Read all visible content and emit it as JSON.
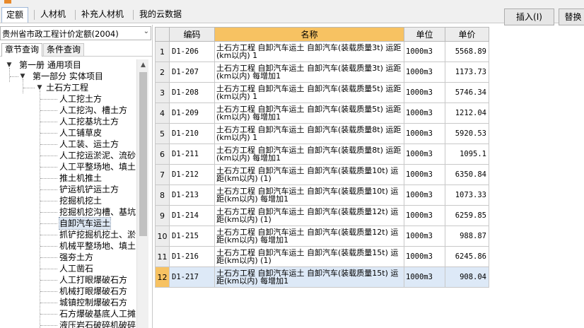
{
  "tabs": [
    "定额",
    "人材机",
    "补充人材机",
    "我的云数据"
  ],
  "toolbar": {
    "insert_label": "插入(I)",
    "replace_label": "替换"
  },
  "library": {
    "selected": "贵州省市政工程计价定额(2004)"
  },
  "subtabs": [
    "章节查询",
    "条件查询"
  ],
  "tree": [
    {
      "label": "第一册 通用项目",
      "level": 0,
      "expanded": true
    },
    {
      "label": "第一部分 实体项目",
      "level": 1,
      "expanded": true
    },
    {
      "label": "土石方工程",
      "level": 2,
      "expanded": true
    },
    {
      "label": "人工挖土方",
      "level": 3
    },
    {
      "label": "人工挖沟、槽土方",
      "level": 3
    },
    {
      "label": "人工挖基坑土方",
      "level": 3
    },
    {
      "label": "人工铺草皮",
      "level": 3
    },
    {
      "label": "人工装、运土方",
      "level": 3
    },
    {
      "label": "人工挖运淤泥、流砂",
      "level": 3
    },
    {
      "label": "人工平整场地、填土",
      "level": 3
    },
    {
      "label": "推土机推土",
      "level": 3
    },
    {
      "label": "铲运机铲运土方",
      "level": 3
    },
    {
      "label": "挖掘机挖土",
      "level": 3
    },
    {
      "label": "挖掘机挖沟槽、基坑",
      "level": 3
    },
    {
      "label": "自卸汽车运土",
      "level": 3,
      "selected": true
    },
    {
      "label": "抓铲挖掘机挖土、淤",
      "level": 3
    },
    {
      "label": "机械平整场地、填土",
      "level": 3
    },
    {
      "label": "强夯土方",
      "level": 3
    },
    {
      "label": "人工凿石",
      "level": 3
    },
    {
      "label": "人工打眼爆破石方",
      "level": 3
    },
    {
      "label": "机械打眼爆破石方",
      "level": 3
    },
    {
      "label": "城镇控制爆破石方",
      "level": 3
    },
    {
      "label": "石方爆破基底人工摊",
      "level": 3
    },
    {
      "label": "液压岩石破碎机破碎",
      "level": 3
    }
  ],
  "grid": {
    "columns": [
      "",
      "编码",
      "名称",
      "单位",
      "单价"
    ],
    "rows": [
      {
        "idx": "1",
        "code": "D1-206",
        "name": "土石方工程 自卸汽车运土 自卸汽车(装载质量3t) 运距(km以内) 1",
        "unit": "1000m3",
        "price": "5568.89"
      },
      {
        "idx": "2",
        "code": "D1-207",
        "name": "土石方工程 自卸汽车运土 自卸汽车(装载质量3t) 运距(km以内) 每增加1",
        "unit": "1000m3",
        "price": "1173.73"
      },
      {
        "idx": "3",
        "code": "D1-208",
        "name": "土石方工程 自卸汽车运土 自卸汽车(装载质量5t) 运距(km以内) 1",
        "unit": "1000m3",
        "price": "5746.34"
      },
      {
        "idx": "4",
        "code": "D1-209",
        "name": "土石方工程 自卸汽车运土 自卸汽车(装载质量5t) 运距(km以内) 每增加1",
        "unit": "1000m3",
        "price": "1212.04"
      },
      {
        "idx": "5",
        "code": "D1-210",
        "name": "土石方工程 自卸汽车运土 自卸汽车(装载质量8t) 运距(km以内) 1",
        "unit": "1000m3",
        "price": "5920.53"
      },
      {
        "idx": "6",
        "code": "D1-211",
        "name": "土石方工程 自卸汽车运土 自卸汽车(装载质量8t) 运距(km以内) 每增加1",
        "unit": "1000m3",
        "price": "1095.1"
      },
      {
        "idx": "7",
        "code": "D1-212",
        "name": "土石方工程 自卸汽车运土 自卸汽车(装载质量10t) 运距(km以内) (1)",
        "unit": "1000m3",
        "price": "6350.84"
      },
      {
        "idx": "8",
        "code": "D1-213",
        "name": "土石方工程 自卸汽车运土 自卸汽车(装载质量10t) 运距(km以内) 每增加1",
        "unit": "1000m3",
        "price": "1073.33"
      },
      {
        "idx": "9",
        "code": "D1-214",
        "name": "土石方工程 自卸汽车运土 自卸汽车(装载质量12t) 运距(km以内) (1)",
        "unit": "1000m3",
        "price": "6259.85"
      },
      {
        "idx": "10",
        "code": "D1-215",
        "name": "土石方工程 自卸汽车运土 自卸汽车(装载质量12t) 运距(km以内) 每增加1",
        "unit": "1000m3",
        "price": "988.87"
      },
      {
        "idx": "11",
        "code": "D1-216",
        "name": "土石方工程 自卸汽车运土 自卸汽车(装载质量15t) 运距(km以内) (1)",
        "unit": "1000m3",
        "price": "6245.86"
      },
      {
        "idx": "12",
        "code": "D1-217",
        "name": "土石方工程 自卸汽车运土 自卸汽车(装载质量15t) 运距(km以内) 每增加1",
        "unit": "1000m3",
        "price": "908.04",
        "selected": true
      }
    ]
  },
  "icons": {
    "expanded": "collapse-triangle-icon",
    "scroll_up": "scroll-up-arrow-icon",
    "dropdown": "chevron-down-icon"
  },
  "colors": {
    "header_highlight": "#f7c262",
    "selection": "#dde9f7",
    "chrome": "#f0f0f0"
  }
}
